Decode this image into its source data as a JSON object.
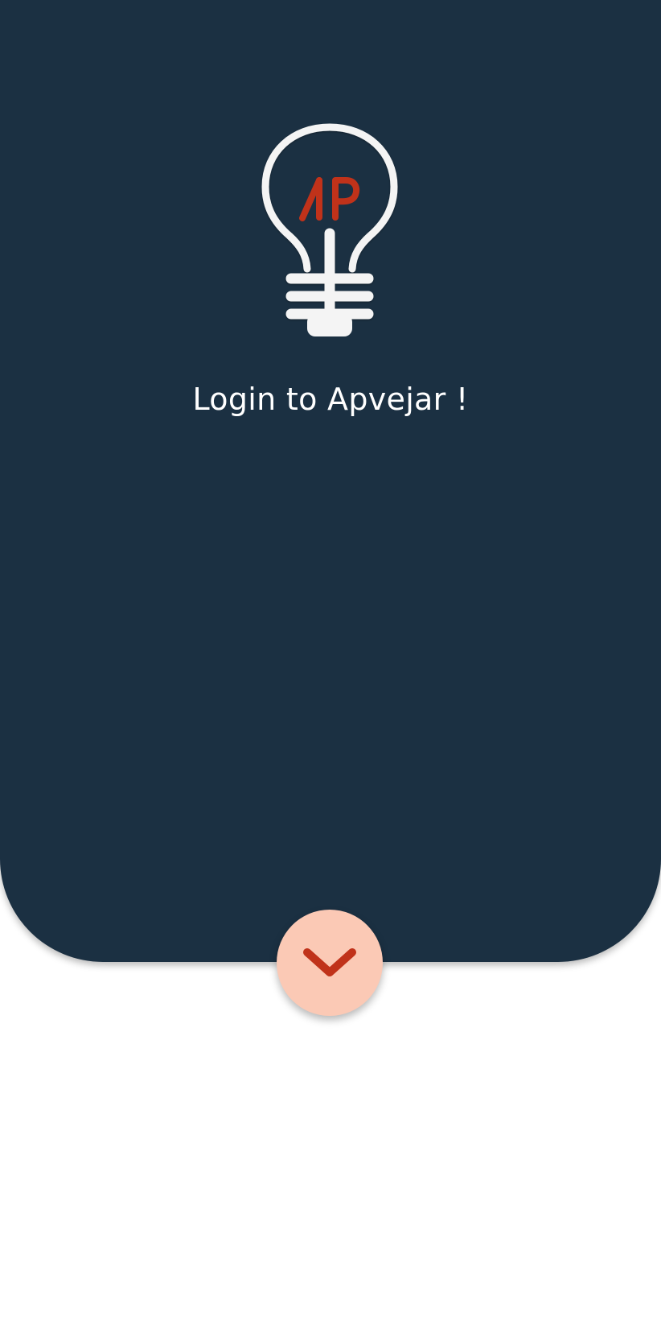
{
  "app": {
    "name": "Apvejar",
    "logo_text": "AP"
  },
  "login_panel": {
    "title": "Login to Apvejar !"
  },
  "toggle": {
    "icon": "chevron-down-icon"
  },
  "colors": {
    "panel_background": "#1b3042",
    "page_background": "#ffffff",
    "accent": "#c0321a",
    "button_background": "#fbc9b5",
    "text": "#ffffff"
  }
}
